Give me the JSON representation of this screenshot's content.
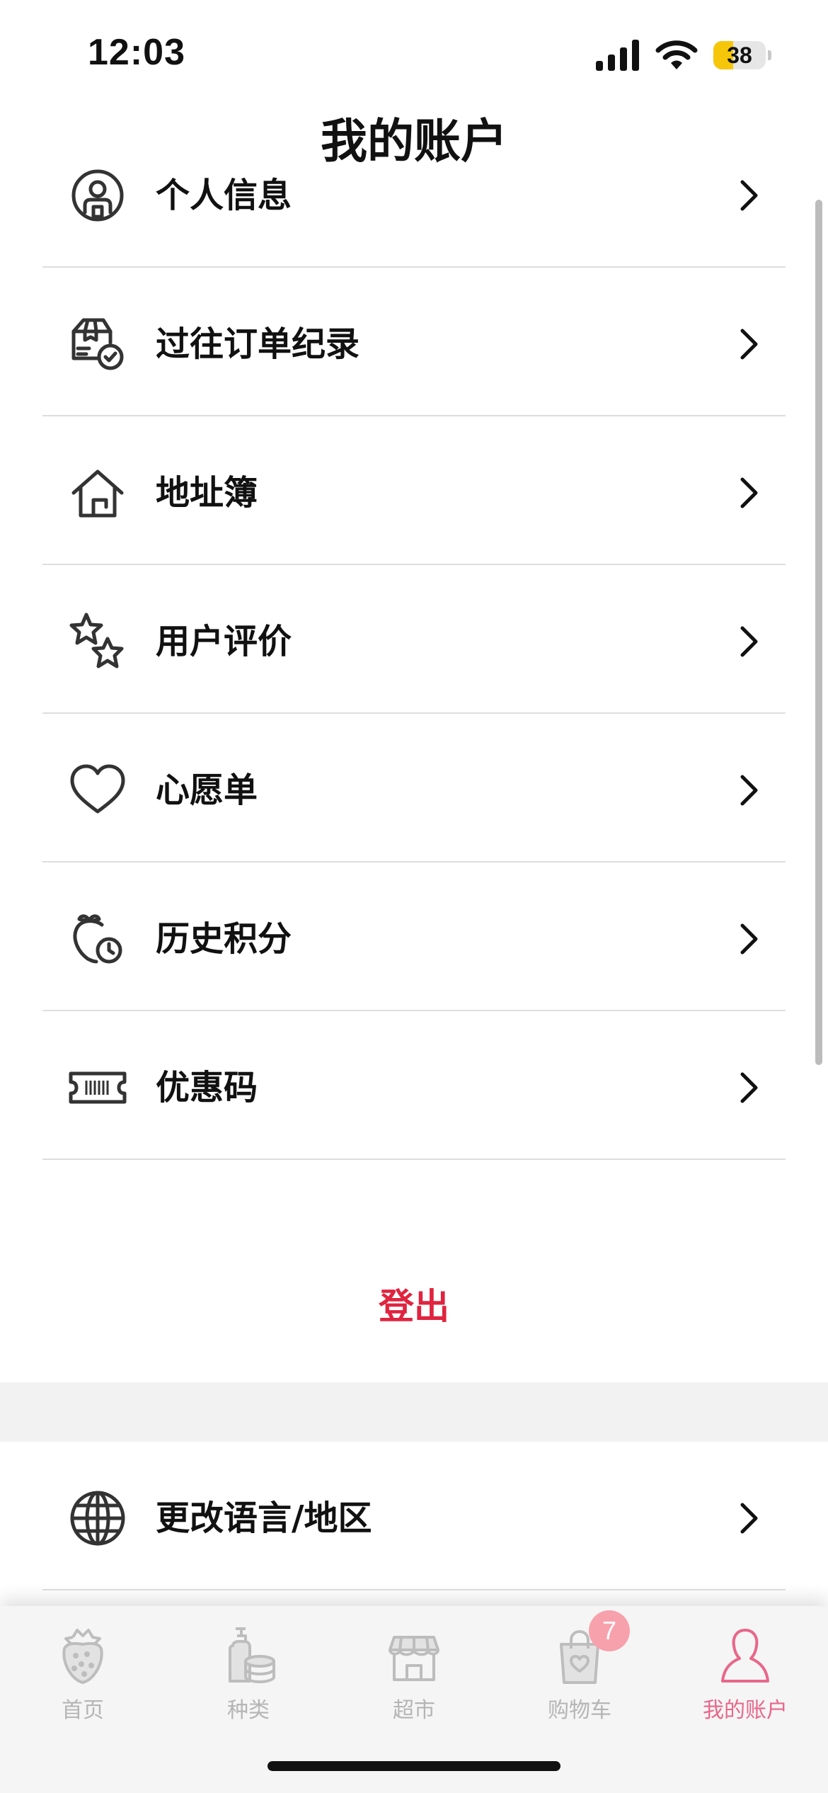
{
  "status": {
    "time": "12:03",
    "battery": "38",
    "battery_level": 0.38
  },
  "title": "我的账户",
  "menu": [
    {
      "label": "个人信息",
      "icon": "user-circle-icon"
    },
    {
      "label": "过往订单纪录",
      "icon": "order-history-icon"
    },
    {
      "label": "地址簿",
      "icon": "house-icon"
    },
    {
      "label": "用户评价",
      "icon": "stars-icon"
    },
    {
      "label": "心愿单",
      "icon": "heart-icon"
    },
    {
      "label": "历史积分",
      "icon": "points-history-icon"
    },
    {
      "label": "优惠码",
      "icon": "coupon-ticket-icon"
    }
  ],
  "logout": "登出",
  "language": {
    "label": "更改语言/地区",
    "icon": "globe-icon"
  },
  "tabs": [
    {
      "label": "首页",
      "icon": "strawberry-icon"
    },
    {
      "label": "种类",
      "icon": "categories-icon"
    },
    {
      "label": "超市",
      "icon": "store-icon"
    },
    {
      "label": "购物车",
      "icon": "shopping-bag-icon",
      "badge": "7"
    },
    {
      "label": "我的账户",
      "icon": "account-icon",
      "active": true
    }
  ],
  "colors": {
    "accent": "#e0243f",
    "tab_active": "#e8678a",
    "tab_inactive": "#b5b5b5",
    "badge": "#f7a1ad",
    "battery": "#f5c60a"
  }
}
